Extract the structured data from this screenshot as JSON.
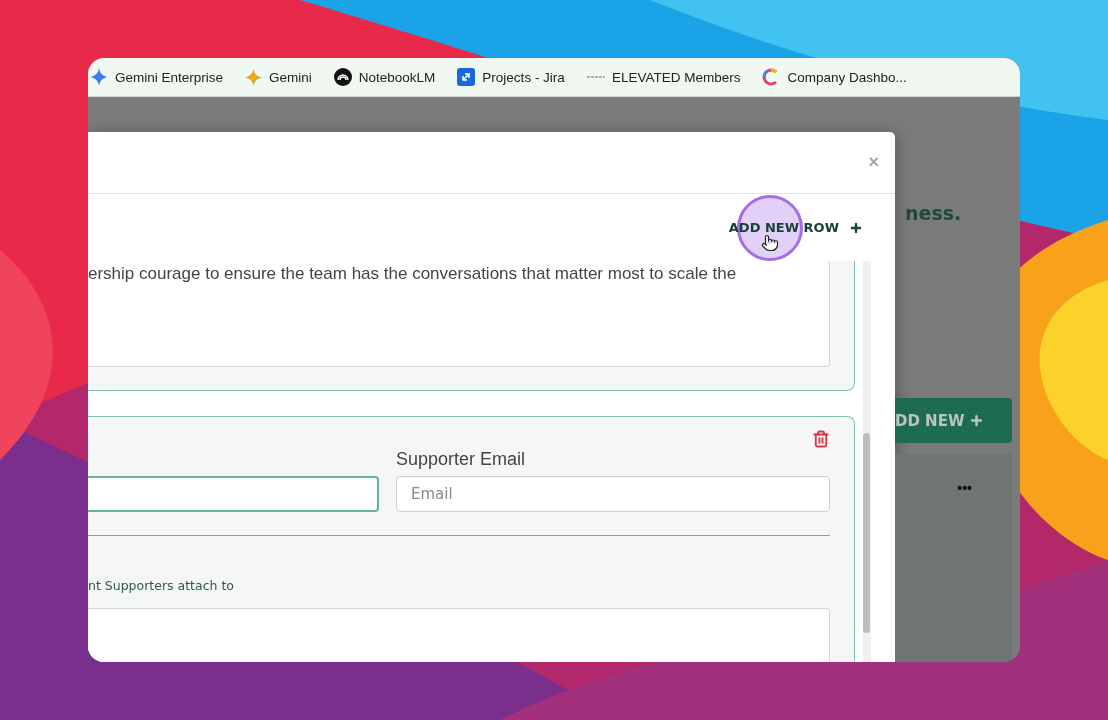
{
  "bookmarks": [
    {
      "label": "Gemini Enterprise",
      "kind": "spark"
    },
    {
      "label": "Gemini",
      "kind": "gemini"
    },
    {
      "label": "NotebookLM",
      "kind": "notebook"
    },
    {
      "label": "Projects - Jira",
      "kind": "jira"
    },
    {
      "label": "ELEVATED Members",
      "kind": "dots"
    },
    {
      "label": "Company Dashbo...",
      "kind": "ring"
    }
  ],
  "modal": {
    "close": "×",
    "add_row_button": "ADD NEW ROW",
    "cards": [
      {
        "kind": "statement",
        "textarea_value": "ership courage to ensure the team has the conversations that matter most to scale the"
      },
      {
        "kind": "supporter",
        "name_focused": true,
        "email_label": "Supporter Email",
        "email_placeholder": "Email",
        "attach_label": "nt Supporters attach to"
      }
    ]
  },
  "background_page": {
    "heading": "ness.",
    "add_new_button": "DD NEW",
    "more": "•••"
  }
}
